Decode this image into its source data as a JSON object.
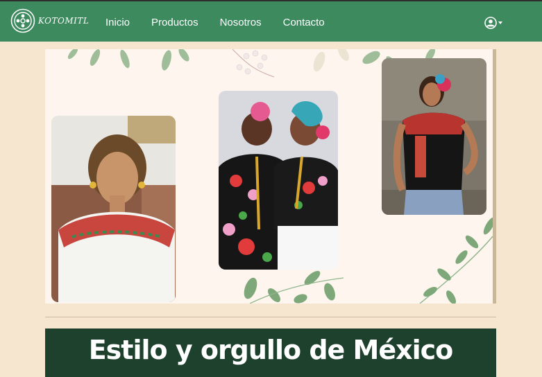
{
  "brand": {
    "name": "KOTOMITL",
    "logo_icon": "flower-emblem-icon"
  },
  "nav": {
    "links": [
      {
        "label": "Inicio"
      },
      {
        "label": "Productos"
      },
      {
        "label": "Nosotros"
      },
      {
        "label": "Contacto"
      }
    ],
    "account_icon": "user-circle-icon",
    "dropdown_icon": "caret-down-icon"
  },
  "hero": {
    "photos": [
      {
        "alt": "woman-white-embroidered-blouse"
      },
      {
        "alt": "two-women-traditional-dress"
      },
      {
        "alt": "woman-black-embroidered-blouse"
      }
    ]
  },
  "headline": {
    "text": "Estilo y orgullo de México"
  },
  "colors": {
    "navbar": "#3d8a5f",
    "page_bg": "#f7e6cf",
    "title_band": "#1e412d",
    "hero_bg": "#fdf5ee"
  }
}
